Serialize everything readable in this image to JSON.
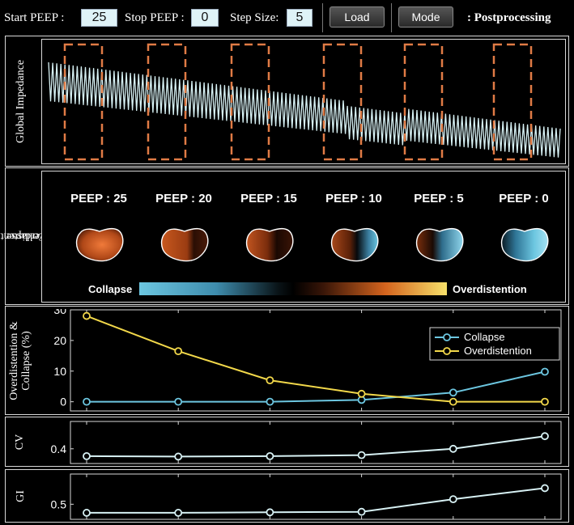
{
  "toolbar": {
    "start_peep_label": "Start PEEP :",
    "start_peep_value": "25",
    "stop_peep_label": "Stop PEEP :",
    "stop_peep_value": "0",
    "step_size_label": "Step Size:",
    "step_size_value": "5",
    "load_label": "Load",
    "mode_label": "Mode",
    "mode_value": ": Postprocessing"
  },
  "impedance_panel": {
    "label": "Global Impedance"
  },
  "images_panel": {
    "label_line1": "Overdistention &",
    "label_line2": "Collapse",
    "peep_titles": [
      "PEEP : 25",
      "PEEP : 20",
      "PEEP : 15",
      "PEEP : 10",
      "PEEP : 5",
      "PEEP : 0"
    ],
    "colorbar_left": "Collapse",
    "colorbar_right": "Overdistention"
  },
  "colors": {
    "collapse": "#6cc6e0",
    "overdistention": "#f2d84a",
    "trace": "#d7f1f4",
    "box": "#e07b45"
  },
  "chart_data": [
    {
      "name": "overdistention_collapse",
      "type": "line",
      "ylabel": "Overdistention & Collapse (%)",
      "x": [
        25,
        20,
        15,
        10,
        5,
        0
      ],
      "ylim": [
        -3,
        30
      ],
      "yticks": [
        0,
        10,
        20,
        30
      ],
      "series": [
        {
          "name": "Collapse",
          "values": [
            0,
            0,
            0,
            0.6,
            3,
            9.8
          ]
        },
        {
          "name": "Overdistention",
          "values": [
            28,
            16.5,
            7,
            2.6,
            0,
            0
          ]
        }
      ],
      "legend": "top-right"
    },
    {
      "name": "cv",
      "type": "line",
      "ylabel": "CV",
      "x": [
        25,
        20,
        15,
        10,
        5,
        0
      ],
      "ylim": [
        0.33,
        0.53
      ],
      "yticks": [
        0.4
      ],
      "series": [
        {
          "name": "",
          "values": [
            0.365,
            0.363,
            0.365,
            0.37,
            0.4,
            0.46
          ]
        }
      ]
    },
    {
      "name": "gi",
      "type": "line",
      "ylabel": "GI",
      "x": [
        25,
        20,
        15,
        10,
        5,
        0
      ],
      "ylim": [
        0.47,
        0.56
      ],
      "yticks": [
        0.5
      ],
      "series": [
        {
          "name": "",
          "values": [
            0.483,
            0.483,
            0.484,
            0.485,
            0.51,
            0.532
          ]
        }
      ]
    }
  ]
}
